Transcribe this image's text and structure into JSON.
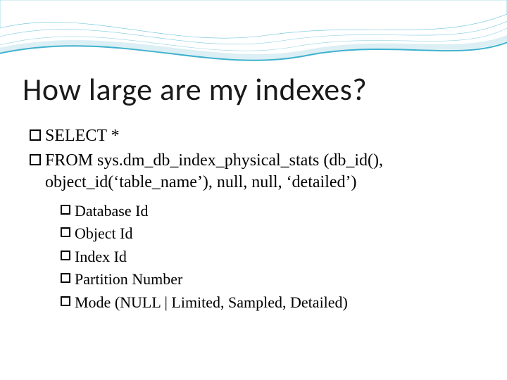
{
  "title": "How large are my indexes?",
  "bullets": {
    "l1_0": "SELECT *",
    "l1_1": "FROM sys.dm_db_index_physical_stats (db_id(), object_id(‘table_name’), null, null, ‘detailed’)",
    "l2_0": "Database Id",
    "l2_1": "Object Id",
    "l2_2": "Index Id",
    "l2_3": "Partition Number",
    "l2_4": "Mode (NULL | Limited, Sampled, Detailed)"
  }
}
